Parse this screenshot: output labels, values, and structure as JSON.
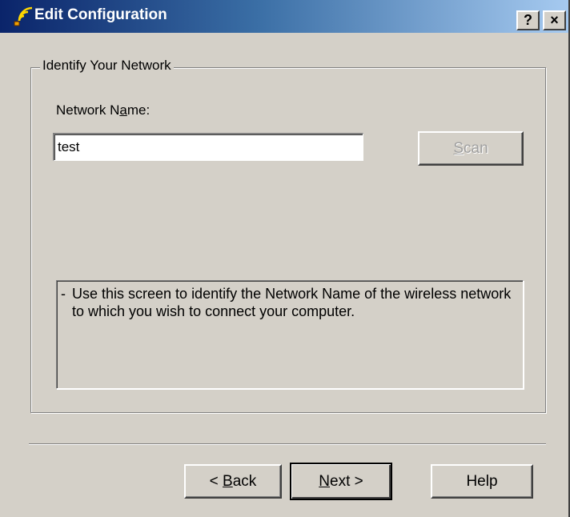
{
  "window": {
    "title": "Edit Configuration",
    "help_glyph": "?",
    "close_glyph": "×"
  },
  "group": {
    "legend": "Identify Your Network"
  },
  "network_name": {
    "label_before": "Network N",
    "label_mnemonic": "a",
    "label_after": "me:",
    "value": "test"
  },
  "scan_button": {
    "mnemonic": "S",
    "rest": "can",
    "enabled": false
  },
  "info": {
    "dash": "-",
    "text": "Use this screen to identify the Network Name of the wireless network to which you wish to connect your computer."
  },
  "buttons": {
    "back_prefix": "< ",
    "back_mnemonic": "B",
    "back_rest": "ack",
    "next_mnemonic": "N",
    "next_rest": "ext >",
    "help_label": "Help"
  },
  "icons": {
    "app": "wireless-signal-icon"
  },
  "colors": {
    "titlebar_start": "#0a246a",
    "titlebar_end": "#a6caf0",
    "face": "#d4d0c8"
  }
}
